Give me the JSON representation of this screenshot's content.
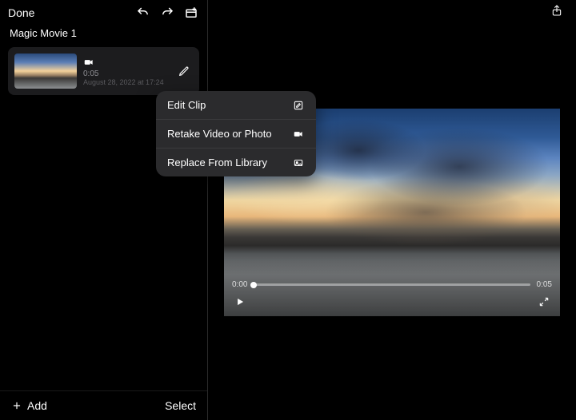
{
  "header": {
    "done_label": "Done"
  },
  "project": {
    "title": "Magic Movie 1"
  },
  "clip": {
    "duration": "0:05",
    "date": "August 28, 2022 at 17:24"
  },
  "context_menu": {
    "edit_label": "Edit Clip",
    "retake_label": "Retake Video or Photo",
    "replace_label": "Replace From Library"
  },
  "bottom": {
    "add_label": "Add",
    "select_label": "Select"
  },
  "player": {
    "current_time": "0:00",
    "total_time": "0:05"
  }
}
